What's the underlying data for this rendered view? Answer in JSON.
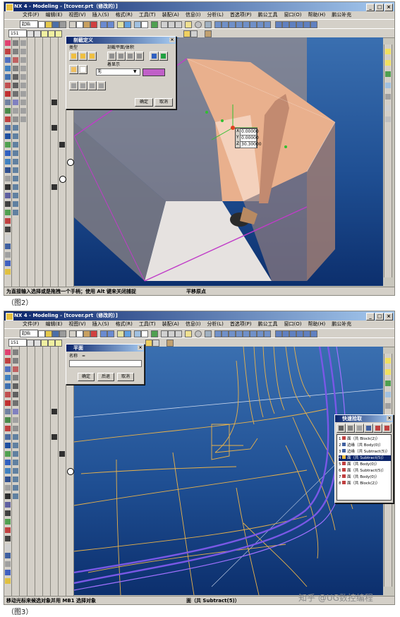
{
  "screen1": {
    "title": "NX 4 - Modeling - [tcover.prt（修改的）]",
    "menu": [
      "文件(F)",
      "编辑(E)",
      "视图(V)",
      "插入(S)",
      "格式(R)",
      "工具(T)",
      "装配(A)",
      "信息(I)",
      "分析(L)",
      "首选项(P)",
      "鹏公工具",
      "窗口(O)",
      "帮助(H)",
      "鹏公补充"
    ],
    "toolbar_combo": "起始",
    "layer_combo": "151",
    "dialog": {
      "title": "剖截定义",
      "type_label": "类型",
      "plane_label": "剖截平面/体积",
      "display_label": "着显示",
      "display_value": "无",
      "ok": "确定",
      "cancel": "取消"
    },
    "coords": {
      "x": "0.00000",
      "y": "0.00000",
      "z": "30.30000"
    },
    "coord_labels": [
      "X",
      "Y",
      "Z"
    ],
    "status_left": "为直接输入选择或是拖拽一个手柄；使用 Alt 键来关闭捕捉",
    "status_right": "平移原点",
    "caption": "（图2）"
  },
  "screen2": {
    "title": "NX 4 - Modeling - [tcover.prt（修改的）]",
    "menu": [
      "文件(F)",
      "编辑(E)",
      "视图(V)",
      "插入(S)",
      "格式(R)",
      "工具(T)",
      "装配(A)",
      "信息(I)",
      "分析(L)",
      "首选项(P)",
      "鹏公工具",
      "窗口(O)",
      "帮助(H)",
      "鹏公补充"
    ],
    "toolbar_combo": "起始",
    "layer_combo": "151",
    "dialog": {
      "title": "平面",
      "name_label": "名称",
      "name_value": "=",
      "ok": "确定",
      "back": "后退",
      "cancel": "取消"
    },
    "navigator": {
      "title": "快速拾取",
      "rows": [
        {
          "n": "1",
          "text": "面（共 Block(2)）",
          "selected": false
        },
        {
          "n": "2",
          "text": "边缘（共 Body(0)）",
          "selected": false
        },
        {
          "n": "3",
          "text": "边缘（共 Subtract(5)）",
          "selected": false
        },
        {
          "n": "4",
          "text": "面（共 Subtract(5)）",
          "selected": true
        },
        {
          "n": "5",
          "text": "面（共 Body(0)）",
          "selected": false
        },
        {
          "n": "6",
          "text": "面（共 Subtract(5)）",
          "selected": false
        },
        {
          "n": "7",
          "text": "面（共 Body(0)）",
          "selected": false
        },
        {
          "n": "8",
          "text": "面（共 Block(2)）",
          "selected": false
        }
      ]
    },
    "status_left": "移动光标来候选对象并用 MB1 选择对象",
    "status_right": "面（共 Subtract(5)）",
    "caption": "（图3）"
  },
  "watermark": "知乎 @UG数控编程",
  "colors": {
    "title_bar": "#0a246a",
    "viewport_top": "#3a6fb0",
    "viewport_bottom": "#0c2f6d",
    "solid": "#e9b08d",
    "edge_magenta": "#c03cc8",
    "wire": "#e9b24a",
    "purple_curve": "#7a58e6"
  }
}
